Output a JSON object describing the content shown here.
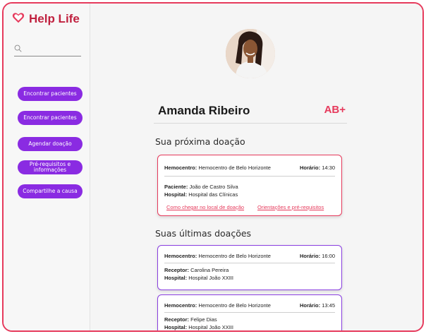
{
  "app": {
    "logo_text": "Help Life",
    "brand_color": "#c0213f",
    "accent_color": "#8a2be2",
    "icons": [
      "heart-icon",
      "search-icon"
    ]
  },
  "search": {
    "placeholder": ""
  },
  "sidebar": {
    "items": [
      {
        "label": "Encontrar pacientes"
      },
      {
        "label": "Encontrar pacientes"
      },
      {
        "label": "Agendar doação"
      },
      {
        "label": "Pré-requisitos e informações"
      },
      {
        "label": "Compartilhe a causa"
      }
    ]
  },
  "profile": {
    "name": "Amanda Ribeiro",
    "blood_type": "AB+"
  },
  "next_donation": {
    "title": "Sua próxima doação",
    "hemocentro_label": "Hemocentro:",
    "hemocentro": "Hemocentro de Belo Horizonte",
    "time_label": "Horário:",
    "time": "14:30",
    "patient_label": "Paciente:",
    "patient": "João de Castro Silva",
    "hospital_label": "Hospital:",
    "hospital": "Hospital das Clínicas",
    "link_directions": "Como chegar no local de doação",
    "link_guidance": "Orientações e pré-requisitos"
  },
  "past_donations": {
    "title": "Suas últimas doações",
    "items": [
      {
        "hemocentro_label": "Hemocentro:",
        "hemocentro": "Hemocentro de Belo Horizonte",
        "time_label": "Horário:",
        "time": "16:00",
        "receptor_label": "Receptor:",
        "receptor": "Carolina Pereira",
        "hospital_label": "Hospital:",
        "hospital": "Hospital João XXIII"
      },
      {
        "hemocentro_label": "Hemocentro:",
        "hemocentro": "Hemocentro de Belo Horizonte",
        "time_label": "Horário:",
        "time": "13:45",
        "receptor_label": "Receptor:",
        "receptor": "Felipe Dias",
        "hospital_label": "Hospital:",
        "hospital": "Hospital João XXIII"
      }
    ]
  }
}
